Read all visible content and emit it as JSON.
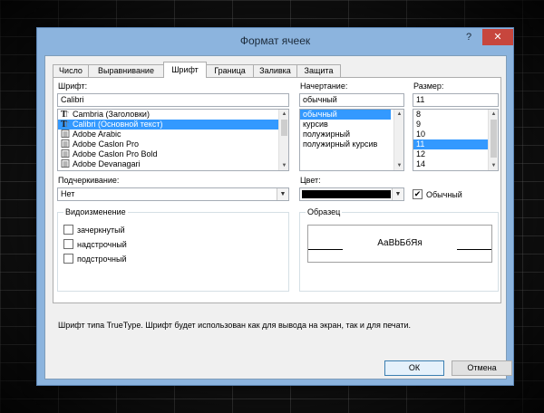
{
  "window": {
    "title": "Формат ячеек",
    "help": "?",
    "close": "✕"
  },
  "tabs": [
    "Число",
    "Выравнивание",
    "Шрифт",
    "Граница",
    "Заливка",
    "Защита"
  ],
  "active_tab": "Шрифт",
  "font": {
    "label": "Шрифт:",
    "value": "Calibri",
    "items": [
      {
        "name": "Cambria (Заголовки)",
        "icon": "truetype-icon"
      },
      {
        "name": "Calibri (Основной текст)",
        "icon": "truetype-icon",
        "selected": true
      },
      {
        "name": "Adobe Arabic",
        "icon": "opentype-icon"
      },
      {
        "name": "Adobe Caslon Pro",
        "icon": "opentype-icon"
      },
      {
        "name": "Adobe Caslon Pro Bold",
        "icon": "opentype-icon"
      },
      {
        "name": "Adobe Devanagari",
        "icon": "opentype-icon"
      }
    ]
  },
  "style": {
    "label": "Начертание:",
    "value": "обычный",
    "items": [
      "обычный",
      "курсив",
      "полужирный",
      "полужирный курсив"
    ],
    "selected": 0
  },
  "size": {
    "label": "Размер:",
    "value": "11",
    "items": [
      "8",
      "9",
      "10",
      "11",
      "12",
      "14"
    ],
    "selected": 3
  },
  "underline": {
    "label": "Подчеркивание:",
    "value": "Нет"
  },
  "color": {
    "label": "Цвет:",
    "swatch": "#000000",
    "normal_font_label": "Обычный",
    "normal_font_checked": true
  },
  "effects": {
    "title": "Видоизменение",
    "items": [
      {
        "label": "зачеркнутый",
        "checked": false
      },
      {
        "label": "надстрочный",
        "checked": false
      },
      {
        "label": "подстрочный",
        "checked": false
      }
    ]
  },
  "preview": {
    "title": "Образец",
    "text": "АаВbБбЯя"
  },
  "info_text": "Шрифт типа TrueType. Шрифт будет использован как для вывода на экран, так и для печати.",
  "buttons": {
    "ok": "ОК",
    "cancel": "Отмена"
  },
  "colors": {
    "selection": "#3399ff",
    "close": "#c7463d",
    "frame": "#8cb4de"
  }
}
